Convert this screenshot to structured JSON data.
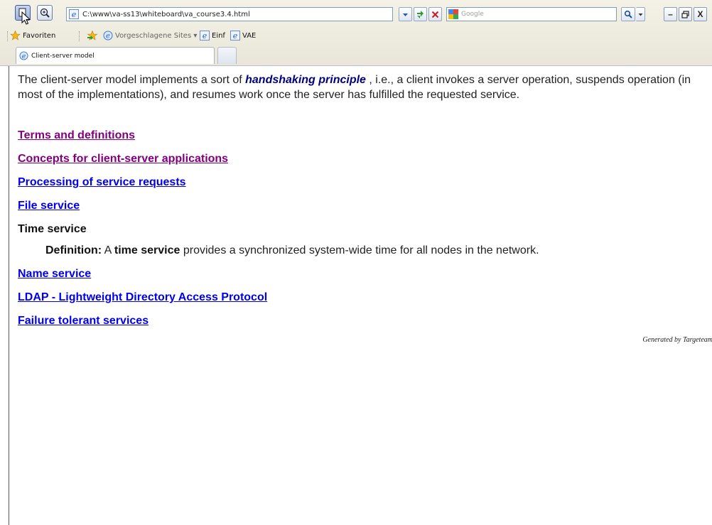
{
  "browser": {
    "address_url": "C:\\www\\va-ss13\\whiteboard\\va_course3.4.html",
    "search_placeholder": "Google",
    "favorites_label": "Favoriten",
    "suggested_sites_label": "Vorgeschlagene Sites ▾",
    "bookmark_einf": "Einf",
    "bookmark_vae": "VAE",
    "tab_title": "Client-server model",
    "min_glyph": "–",
    "restore_glyph": "❐",
    "close_glyph": "X",
    "icons": {
      "select": "select-arrow-icon",
      "zoom": "magnifier-icon",
      "page": "ie-page-icon",
      "refresh": "refresh-icon",
      "stop": "stop-icon",
      "search": "search-icon"
    }
  },
  "page": {
    "intro_before": "The client-server model implements a sort of ",
    "intro_emph": "handshaking principle",
    "intro_after": " , i.e., a client invokes a server operation, suspends operation (in most of the implementations), and resumes work once the server has fulfilled the requested service.",
    "links": [
      {
        "label": "Terms and definitions",
        "visited": true
      },
      {
        "label": "Concepts for client-server applications",
        "visited": true
      },
      {
        "label": "Processing of service requests",
        "visited": false
      },
      {
        "label": "File service",
        "visited": false
      }
    ],
    "current_section": "Time service",
    "definition_label": "Definition:",
    "definition_a": " A ",
    "definition_term": "time service",
    "definition_rest": " provides a synchronized system-wide time for all nodes in the network.",
    "links_after": [
      {
        "label": "Name service",
        "visited": false
      },
      {
        "label": "LDAP - Lightweight Directory Access Protocol",
        "visited": false
      },
      {
        "label": "Failure tolerant services",
        "visited": false
      }
    ],
    "generated_by": "Generated by Targeteam"
  },
  "colors": {
    "visited_link": "#800080",
    "unvisited_link": "#0000ee",
    "emphasis": "#000080"
  }
}
